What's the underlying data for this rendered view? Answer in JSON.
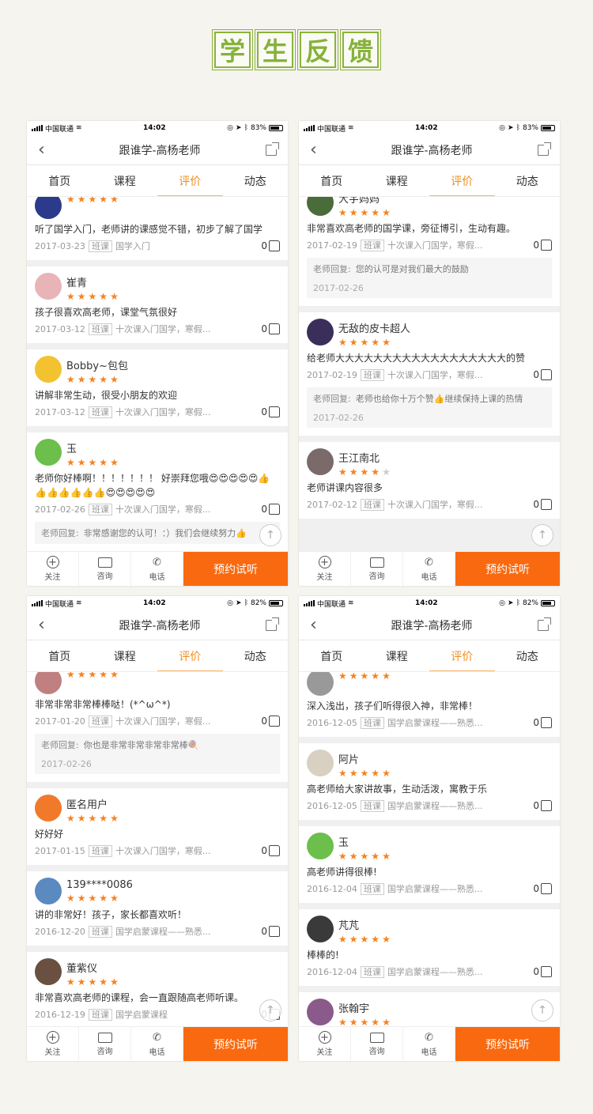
{
  "page_title": [
    "学",
    "生",
    "反",
    "馈"
  ],
  "app": {
    "title": "跟谁学-高杨老师",
    "tabs": [
      "首页",
      "课程",
      "评价",
      "动态"
    ],
    "active_tab": "评价",
    "bottom": {
      "follow": "关注",
      "consult": "咨询",
      "phone": "电话",
      "book": "预约试听"
    },
    "carrier": "中国联通",
    "time": "14:02",
    "accent": "#f28c1e",
    "book_color": "#f96a10"
  },
  "screens": [
    {
      "battery": "83%",
      "reviews": [
        {
          "name": "",
          "comment": "听了国学入门，老师讲的课感觉不错，初步了解了国学",
          "date": "2017-03-23",
          "badge": "班课",
          "course": "国学入门",
          "likes": "0",
          "stars": 5,
          "avatar_color": "#2b3a8a"
        },
        {
          "name": "崔青",
          "comment": "孩子很喜欢高老师，课堂气氛很好",
          "date": "2017-03-12",
          "badge": "班课",
          "course": "十次课入门国学，寒假...",
          "likes": "0",
          "stars": 5,
          "avatar_color": "#e8b4b8"
        },
        {
          "name": "Bobby~包包",
          "comment": "讲解非常生动，很受小朋友的欢迎",
          "date": "2017-03-12",
          "badge": "班课",
          "course": "十次课入门国学，寒假...",
          "likes": "0",
          "stars": 5,
          "avatar_color": "#f2c230"
        },
        {
          "name": "玉",
          "comment": "老师你好棒啊！！！！！！！ 好崇拜您哦😍😍😍😍😍👍👍👍👍👍👍👍😍😍😍😍😍",
          "date": "2017-02-26",
          "badge": "班课",
          "course": "十次课入门国学，寒假...",
          "likes": "0",
          "stars": 5,
          "avatar_color": "#6cbf4a",
          "reply": {
            "label": "老师回复:",
            "text": "非常感谢您的认可！：）我们会继续努力👍"
          }
        }
      ]
    },
    {
      "battery": "83%",
      "reviews": [
        {
          "name": "大宇妈妈",
          "comment": "非常喜欢高老师的国学课，旁征博引，生动有趣。",
          "date": "2017-02-19",
          "badge": "班课",
          "course": "十次课入门国学，寒假...",
          "likes": "0",
          "stars": 5,
          "avatar_color": "#4a6b3a",
          "reply": {
            "label": "老师回复:",
            "text": "您的认可是对我们最大的鼓励",
            "date": "2017-02-26"
          }
        },
        {
          "name": "无敌的皮卡超人",
          "comment": "给老师大大大大大大大大大大大大大大大大大大的赞",
          "date": "2017-02-19",
          "badge": "班课",
          "course": "十次课入门国学，寒假...",
          "likes": "0",
          "stars": 5,
          "avatar_color": "#3a2f5a",
          "reply": {
            "label": "老师回复:",
            "text": "老师也给你十万个赞👍继续保持上课的热情",
            "date": "2017-02-26"
          }
        },
        {
          "name": "王江南北",
          "comment": "老师讲课内容很多",
          "date": "2017-02-12",
          "badge": "班课",
          "course": "十次课入门国学，寒假...",
          "likes": "0",
          "stars": 4,
          "avatar_color": "#7a6a6a"
        }
      ]
    },
    {
      "battery": "82%",
      "reviews": [
        {
          "name": "",
          "comment": "非常非常非常棒棒哒！(*^ω^*)",
          "date": "2017-01-20",
          "badge": "班课",
          "course": "十次课入门国学，寒假...",
          "likes": "0",
          "stars": 5,
          "avatar_color": "#c08080",
          "reply": {
            "label": "老师回复:",
            "text": "你也是非常非常非常非常棒🍭",
            "date": "2017-02-26"
          }
        },
        {
          "name": "匿名用户",
          "comment": "好好好",
          "date": "2017-01-15",
          "badge": "班课",
          "course": "十次课入门国学，寒假...",
          "likes": "0",
          "stars": 5,
          "avatar_color": "#f07a2a"
        },
        {
          "name": "139****0086",
          "comment": "讲的非常好！孩子，家长都喜欢听！",
          "date": "2016-12-20",
          "badge": "班课",
          "course": "国学启蒙课程——熟悉...",
          "likes": "0",
          "stars": 5,
          "avatar_color": "#5a8ac0"
        },
        {
          "name": "董紫仪",
          "comment": "非常喜欢高老师的课程，会一直跟随高老师听课。",
          "date": "2016-12-19",
          "badge": "班课",
          "course": "国学启蒙课程",
          "likes": "0",
          "stars": 5,
          "avatar_color": "#6a5040"
        }
      ]
    },
    {
      "battery": "82%",
      "reviews": [
        {
          "name": "",
          "comment": "深入浅出，孩子们听得很入神，非常棒！",
          "date": "2016-12-05",
          "badge": "班课",
          "course": "国学启蒙课程——熟悉...",
          "likes": "0",
          "stars": 5,
          "avatar_color": "#999"
        },
        {
          "name": "阿片",
          "comment": "高老师给大家讲故事，生动活泼，寓教于乐",
          "date": "2016-12-05",
          "badge": "班课",
          "course": "国学启蒙课程——熟悉...",
          "likes": "0",
          "stars": 5,
          "avatar_color": "#d8d0c0"
        },
        {
          "name": "玉",
          "comment": "高老师讲得很棒!",
          "date": "2016-12-04",
          "badge": "班课",
          "course": "国学启蒙课程——熟悉...",
          "likes": "0",
          "stars": 5,
          "avatar_color": "#6cbf4a"
        },
        {
          "name": "芃芃",
          "comment": "棒棒的!",
          "date": "2016-12-04",
          "badge": "班课",
          "course": "国学启蒙课程——熟悉...",
          "likes": "0",
          "stars": 5,
          "avatar_color": "#3a3a3a"
        },
        {
          "name": "张翰宇",
          "comment": "",
          "date": "",
          "badge": "",
          "course": "",
          "likes": "",
          "stars": 5,
          "avatar_color": "#8a5a8a"
        }
      ]
    }
  ]
}
